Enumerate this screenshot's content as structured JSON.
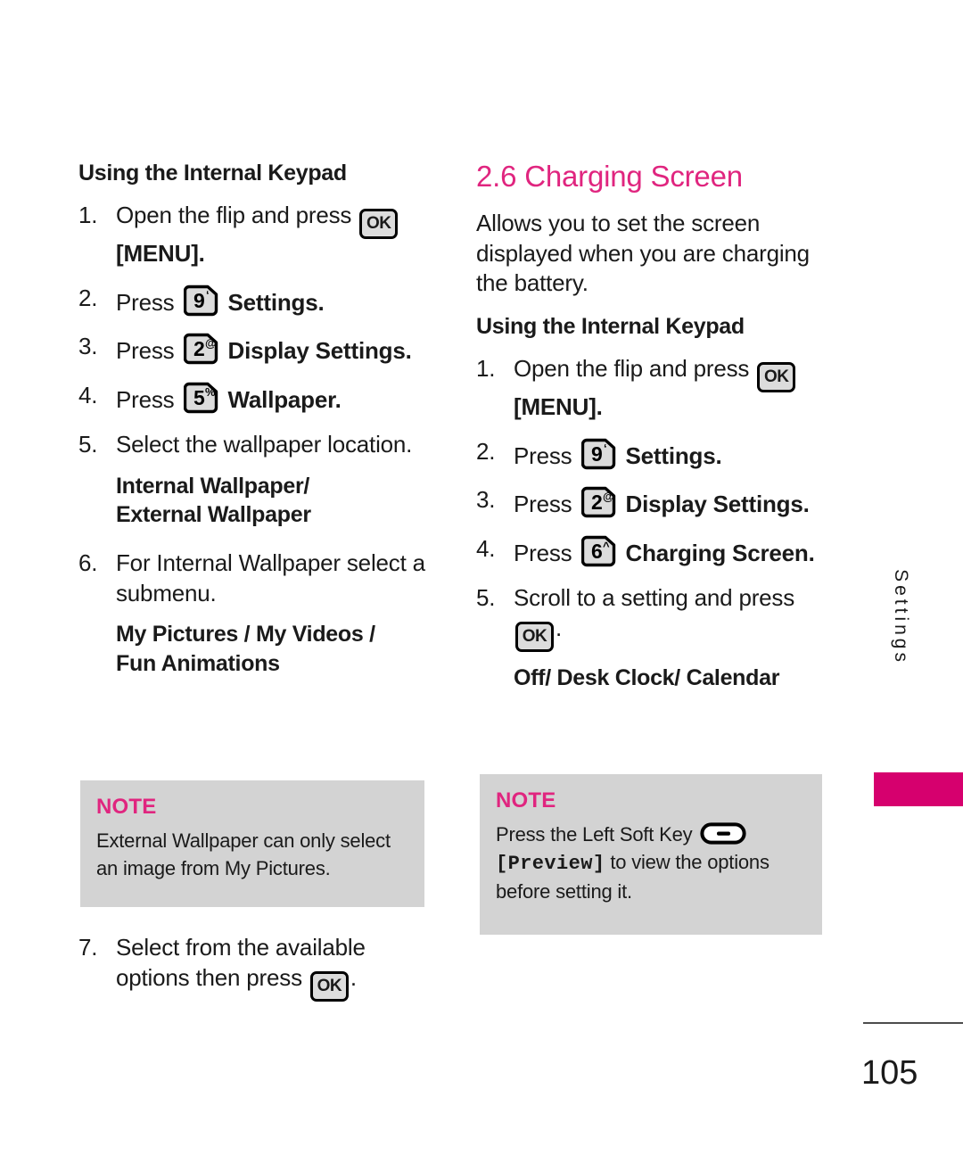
{
  "page": {
    "number": "105",
    "edge_tab_label": "Settings",
    "accent_magenta": "#d6006e",
    "heading_pink": "#e0257f",
    "note_bg": "#d3d3d3"
  },
  "left_column": {
    "heading": "Using the Internal Keypad",
    "steps": [
      {
        "num": "1.",
        "text_before": "Open the flip and press",
        "key": {
          "type": "ok",
          "label": "OK"
        },
        "text_after_bold": "[MENU]."
      },
      {
        "num": "2.",
        "text_before": "Press",
        "key": {
          "type": "numeric",
          "digit": "9",
          "sup": "‘"
        },
        "text_after_bold": "Settings."
      },
      {
        "num": "3.",
        "text_before": "Press",
        "key": {
          "type": "numeric",
          "digit": "2",
          "sup": "@"
        },
        "text_after_bold": "Display Settings."
      },
      {
        "num": "4.",
        "text_before": "Press",
        "key": {
          "type": "numeric",
          "digit": "5",
          "sup": "%"
        },
        "text_after_bold": "Wallpaper."
      },
      {
        "num": "5.",
        "text_before": "Select the wallpaper location.",
        "sub_bold_lines": [
          "Internal Wallpaper/",
          "External Wallpaper"
        ]
      },
      {
        "num": "6.",
        "text_before": "For Internal Wallpaper select a submenu.",
        "sub_bold_lines": [
          "My Pictures / My Videos /",
          "Fun Animations"
        ]
      }
    ],
    "note": {
      "label": "NOTE",
      "text": "External Wallpaper can only select an image from My Pictures."
    },
    "tail_step": {
      "num": "7.",
      "text_before": "Select from the available options then press",
      "key": {
        "type": "ok",
        "label": "OK"
      },
      "text_after": "."
    }
  },
  "right_column": {
    "section_title": "2.6 Charging Screen",
    "intro": "Allows you to set the screen displayed when you are charging the battery.",
    "heading": "Using the Internal Keypad",
    "steps": [
      {
        "num": "1.",
        "text_before": "Open the flip and press",
        "key": {
          "type": "ok",
          "label": "OK"
        },
        "text_after_bold": "[MENU]."
      },
      {
        "num": "2.",
        "text_before": "Press",
        "key": {
          "type": "numeric",
          "digit": "9",
          "sup": "‘"
        },
        "text_after_bold": "Settings."
      },
      {
        "num": "3.",
        "text_before": "Press",
        "key": {
          "type": "numeric",
          "digit": "2",
          "sup": "@"
        },
        "text_after_bold": "Display Settings."
      },
      {
        "num": "4.",
        "text_before": "Press",
        "key": {
          "type": "numeric",
          "digit": "6",
          "sup": "^"
        },
        "text_after_bold": "Charging Screen."
      },
      {
        "num": "5.",
        "text_before": "Scroll to a setting and press",
        "key": {
          "type": "ok",
          "label": "OK"
        },
        "text_after": ".",
        "sub_bold_lines": [
          "Off/ Desk Clock/ Calendar"
        ]
      }
    ],
    "note": {
      "label": "NOTE",
      "text_part1": "Press the Left Soft Key",
      "soft_key_icon": "left-soft-key",
      "text_part2_mono": "[Preview]",
      "text_part3": " to view the options before setting it."
    }
  }
}
